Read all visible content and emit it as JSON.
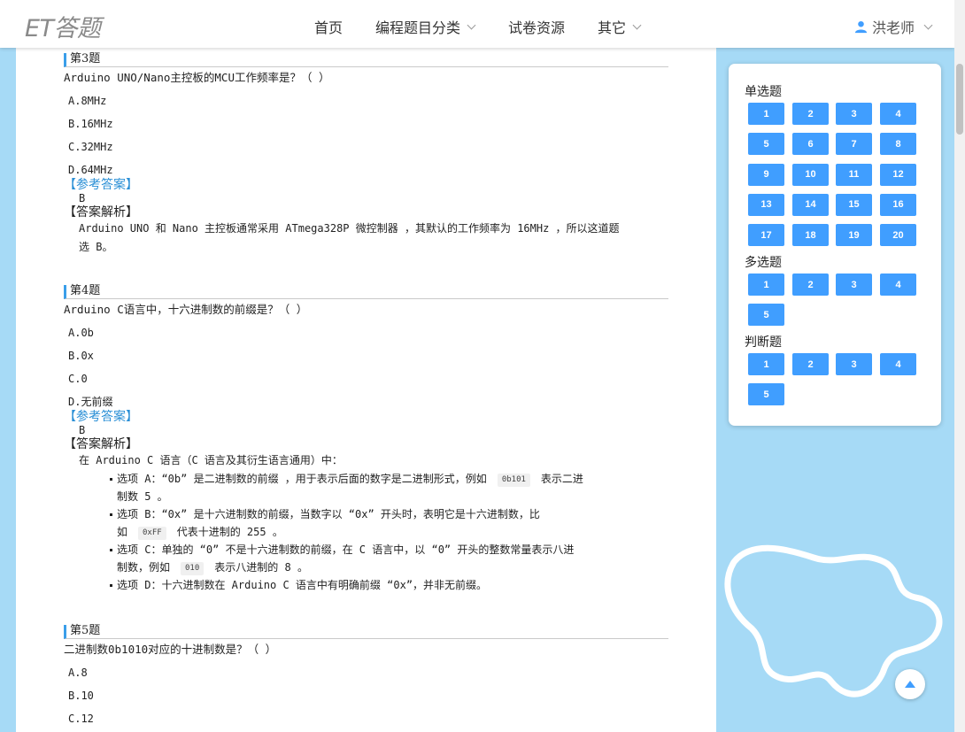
{
  "brand": {
    "logo": "ET答题"
  },
  "nav": {
    "home": "首页",
    "categories": "编程题目分类",
    "papers": "试卷资源",
    "other": "其它"
  },
  "user": {
    "name": "洪老师"
  },
  "labels": {
    "answer": "【参考答案】",
    "explain": "【答案解析】"
  },
  "questions": {
    "q3": {
      "title": "第3题",
      "stem": "Arduino UNO/Nano主控板的MCU工作频率是？（ ）",
      "options": [
        "A.8MHz",
        "B.16MHz",
        "C.32MHz",
        "D.64MHz"
      ],
      "answer": "B",
      "explain_lines": [
        "Arduino UNO 和 Nano 主控板通常采用 ATmega328P 微控制器 ，其默认的工作频率为 16MHz ，所以这道题",
        "选 B。"
      ]
    },
    "q4": {
      "title": "第4题",
      "stem": "Arduino C语言中，十六进制数的前缀是？（ ）",
      "options": [
        "A.0b",
        "B.0x",
        "C.0",
        "D.无前缀"
      ],
      "answer": "B",
      "explain_intro": "在 Arduino C 语言（C 语言及其衍生语言通用）中：",
      "bullets": [
        {
          "a": "选项 A：“0b” 是二进制数的前缀 ，用于表示后面的数字是二进制形式，例如",
          "code": "0b101",
          "b": "表示二进",
          "c": "制数 5 。"
        },
        {
          "a": "选项 B：“0x” 是十六进制数的前缀，当数字以 “0x” 开头时，表明它是十六进制数，比",
          "b0": "如",
          "code": "0xFF",
          "b": "代表十进制的 255 。"
        },
        {
          "a": "选项 C：单独的 “0” 不是十六进制数的前缀，在 C 语言中，以 “0” 开头的整数常量表示八进",
          "b0": "制数，例如",
          "code": "010",
          "b": "表示八进制的 8 。"
        },
        {
          "a": "选项 D：十六进制数在 Arduino C 语言中有明确前缀 “0x”，并非无前缀。"
        }
      ]
    },
    "q5": {
      "title": "第5题",
      "stem": "二进制数0b1010对应的十进制数是？（ ）",
      "options": [
        "A.8",
        "B.10",
        "C.12"
      ]
    }
  },
  "sidebar": {
    "single_label": "单选题",
    "single": [
      "1",
      "2",
      "3",
      "4",
      "5",
      "6",
      "7",
      "8",
      "9",
      "10",
      "11",
      "12",
      "13",
      "14",
      "15",
      "16",
      "17",
      "18",
      "19",
      "20"
    ],
    "multi_label": "多选题",
    "multi": [
      "1",
      "2",
      "3",
      "4",
      "5"
    ],
    "judge_label": "判断题",
    "judge": [
      "1",
      "2",
      "3",
      "4",
      "5"
    ]
  },
  "colors": {
    "accent": "#409eff",
    "answer_blue": "#2a8fd6",
    "page_bg": "#a6daf6"
  }
}
